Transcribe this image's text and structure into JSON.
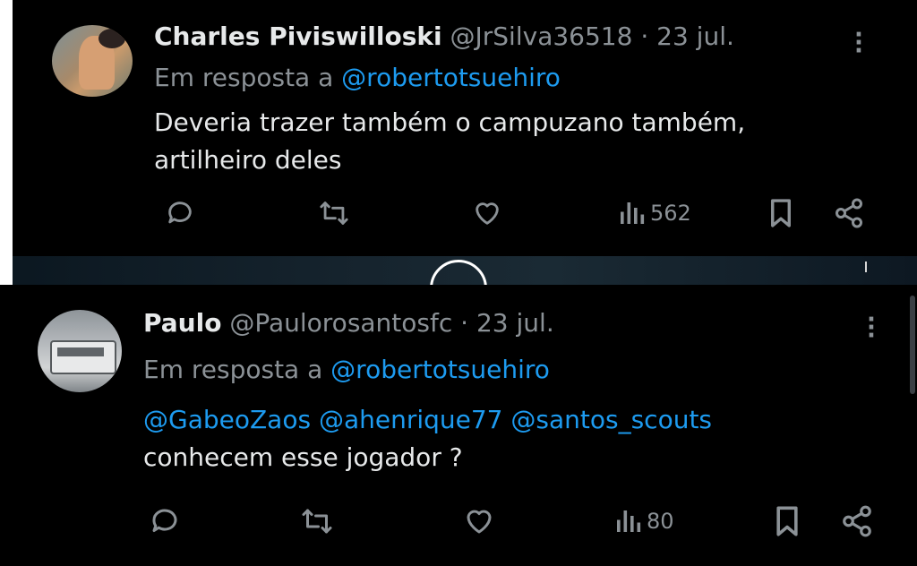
{
  "tweets": [
    {
      "name": "Charles Piviswilloski",
      "handle": "@JrSilva36518",
      "separator": "·",
      "date": "23 jul.",
      "reply_label": "Em resposta a",
      "reply_to": "@robertotsuehiro",
      "body_lines": [
        "Deveria trazer também o campuzano também,",
        "artilheiro deles"
      ],
      "views": "562",
      "icons": [
        "reply-icon",
        "retweet-icon",
        "like-icon",
        "views-icon",
        "bookmark-icon",
        "share-icon"
      ]
    },
    {
      "name": "Paulo",
      "handle": "@Paulorosantosfc",
      "separator": "·",
      "date": "23 jul.",
      "reply_label": "Em resposta a",
      "reply_to": "@robertotsuehiro",
      "mentions": [
        "@GabeoZaos",
        "@ahenrique77",
        "@santos_scouts"
      ],
      "body_lines": [
        "conhecem esse jogador ?"
      ],
      "views": "80",
      "icons": [
        "reply-icon",
        "retweet-icon",
        "like-icon",
        "views-icon",
        "bookmark-icon",
        "share-icon"
      ]
    }
  ],
  "colors": {
    "background": "#000000",
    "text": "#e7e9ea",
    "secondary": "#8b9196",
    "link": "#1d9bf0"
  }
}
